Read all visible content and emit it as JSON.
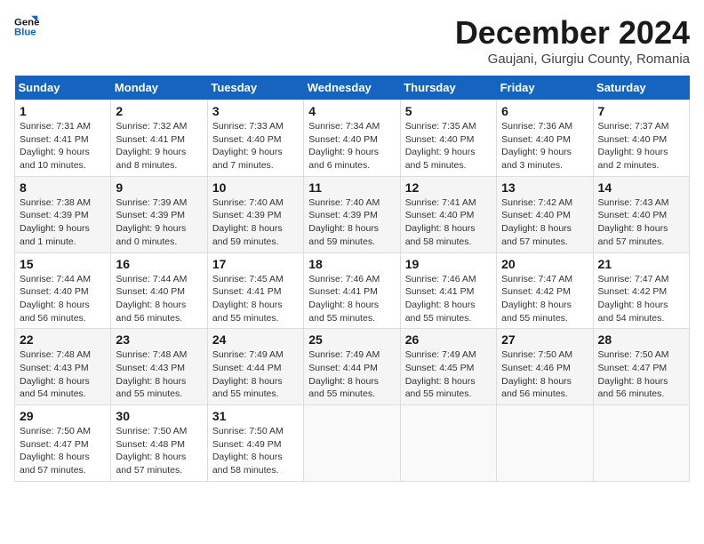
{
  "logo": {
    "line1": "General",
    "line2": "Blue"
  },
  "title": "December 2024",
  "subtitle": "Gaujani, Giurgiu County, Romania",
  "days_of_week": [
    "Sunday",
    "Monday",
    "Tuesday",
    "Wednesday",
    "Thursday",
    "Friday",
    "Saturday"
  ],
  "weeks": [
    [
      {
        "day": "1",
        "info": "Sunrise: 7:31 AM\nSunset: 4:41 PM\nDaylight: 9 hours\nand 10 minutes."
      },
      {
        "day": "2",
        "info": "Sunrise: 7:32 AM\nSunset: 4:41 PM\nDaylight: 9 hours\nand 8 minutes."
      },
      {
        "day": "3",
        "info": "Sunrise: 7:33 AM\nSunset: 4:40 PM\nDaylight: 9 hours\nand 7 minutes."
      },
      {
        "day": "4",
        "info": "Sunrise: 7:34 AM\nSunset: 4:40 PM\nDaylight: 9 hours\nand 6 minutes."
      },
      {
        "day": "5",
        "info": "Sunrise: 7:35 AM\nSunset: 4:40 PM\nDaylight: 9 hours\nand 5 minutes."
      },
      {
        "day": "6",
        "info": "Sunrise: 7:36 AM\nSunset: 4:40 PM\nDaylight: 9 hours\nand 3 minutes."
      },
      {
        "day": "7",
        "info": "Sunrise: 7:37 AM\nSunset: 4:40 PM\nDaylight: 9 hours\nand 2 minutes."
      }
    ],
    [
      {
        "day": "8",
        "info": "Sunrise: 7:38 AM\nSunset: 4:39 PM\nDaylight: 9 hours\nand 1 minute."
      },
      {
        "day": "9",
        "info": "Sunrise: 7:39 AM\nSunset: 4:39 PM\nDaylight: 9 hours\nand 0 minutes."
      },
      {
        "day": "10",
        "info": "Sunrise: 7:40 AM\nSunset: 4:39 PM\nDaylight: 8 hours\nand 59 minutes."
      },
      {
        "day": "11",
        "info": "Sunrise: 7:40 AM\nSunset: 4:39 PM\nDaylight: 8 hours\nand 59 minutes."
      },
      {
        "day": "12",
        "info": "Sunrise: 7:41 AM\nSunset: 4:40 PM\nDaylight: 8 hours\nand 58 minutes."
      },
      {
        "day": "13",
        "info": "Sunrise: 7:42 AM\nSunset: 4:40 PM\nDaylight: 8 hours\nand 57 minutes."
      },
      {
        "day": "14",
        "info": "Sunrise: 7:43 AM\nSunset: 4:40 PM\nDaylight: 8 hours\nand 57 minutes."
      }
    ],
    [
      {
        "day": "15",
        "info": "Sunrise: 7:44 AM\nSunset: 4:40 PM\nDaylight: 8 hours\nand 56 minutes."
      },
      {
        "day": "16",
        "info": "Sunrise: 7:44 AM\nSunset: 4:40 PM\nDaylight: 8 hours\nand 56 minutes."
      },
      {
        "day": "17",
        "info": "Sunrise: 7:45 AM\nSunset: 4:41 PM\nDaylight: 8 hours\nand 55 minutes."
      },
      {
        "day": "18",
        "info": "Sunrise: 7:46 AM\nSunset: 4:41 PM\nDaylight: 8 hours\nand 55 minutes."
      },
      {
        "day": "19",
        "info": "Sunrise: 7:46 AM\nSunset: 4:41 PM\nDaylight: 8 hours\nand 55 minutes."
      },
      {
        "day": "20",
        "info": "Sunrise: 7:47 AM\nSunset: 4:42 PM\nDaylight: 8 hours\nand 55 minutes."
      },
      {
        "day": "21",
        "info": "Sunrise: 7:47 AM\nSunset: 4:42 PM\nDaylight: 8 hours\nand 54 minutes."
      }
    ],
    [
      {
        "day": "22",
        "info": "Sunrise: 7:48 AM\nSunset: 4:43 PM\nDaylight: 8 hours\nand 54 minutes."
      },
      {
        "day": "23",
        "info": "Sunrise: 7:48 AM\nSunset: 4:43 PM\nDaylight: 8 hours\nand 55 minutes."
      },
      {
        "day": "24",
        "info": "Sunrise: 7:49 AM\nSunset: 4:44 PM\nDaylight: 8 hours\nand 55 minutes."
      },
      {
        "day": "25",
        "info": "Sunrise: 7:49 AM\nSunset: 4:44 PM\nDaylight: 8 hours\nand 55 minutes."
      },
      {
        "day": "26",
        "info": "Sunrise: 7:49 AM\nSunset: 4:45 PM\nDaylight: 8 hours\nand 55 minutes."
      },
      {
        "day": "27",
        "info": "Sunrise: 7:50 AM\nSunset: 4:46 PM\nDaylight: 8 hours\nand 56 minutes."
      },
      {
        "day": "28",
        "info": "Sunrise: 7:50 AM\nSunset: 4:47 PM\nDaylight: 8 hours\nand 56 minutes."
      }
    ],
    [
      {
        "day": "29",
        "info": "Sunrise: 7:50 AM\nSunset: 4:47 PM\nDaylight: 8 hours\nand 57 minutes."
      },
      {
        "day": "30",
        "info": "Sunrise: 7:50 AM\nSunset: 4:48 PM\nDaylight: 8 hours\nand 57 minutes."
      },
      {
        "day": "31",
        "info": "Sunrise: 7:50 AM\nSunset: 4:49 PM\nDaylight: 8 hours\nand 58 minutes."
      },
      {
        "day": "",
        "info": ""
      },
      {
        "day": "",
        "info": ""
      },
      {
        "day": "",
        "info": ""
      },
      {
        "day": "",
        "info": ""
      }
    ]
  ]
}
